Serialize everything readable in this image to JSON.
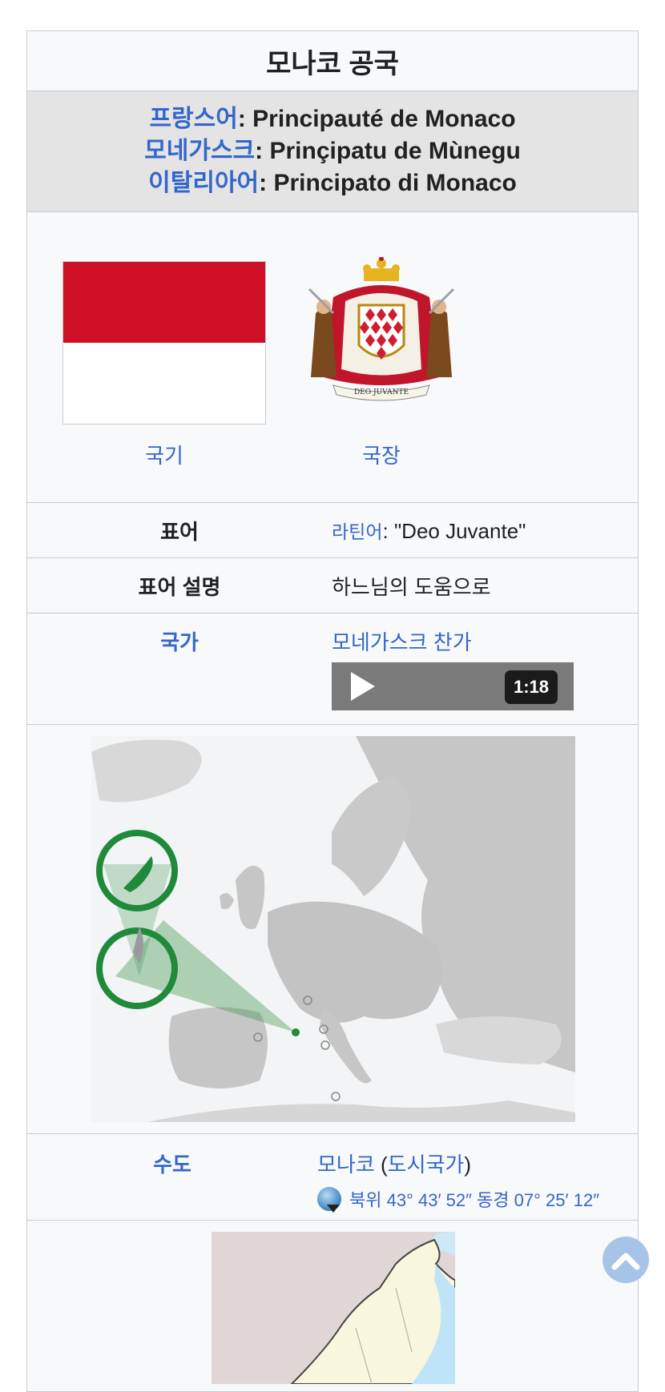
{
  "infobox": {
    "title": "모나코 공국",
    "native_names": [
      {
        "lang": "프랑스어",
        "sep": ": ",
        "name": "Principauté de Monaco"
      },
      {
        "lang": "모네가스크",
        "sep": ": ",
        "name": "Prinçipatu de Mùnegu"
      },
      {
        "lang": "이탈리아어",
        "sep": ": ",
        "name": "Principato di Monaco"
      }
    ],
    "flag_caption": "국기",
    "coa_caption": "국장",
    "coa_motto_ribbon": "DEO JUVANTE",
    "motto": {
      "label": "표어",
      "lang": "라틴어",
      "sep": ": ",
      "text": "\"Deo Juvante\""
    },
    "motto_desc": {
      "label": "표어 설명",
      "text": "하느님의 도움으로"
    },
    "anthem": {
      "label": "국가",
      "name": "모네가스크 찬가",
      "duration": "1:18"
    },
    "capital": {
      "label": "수도",
      "name": "모나코",
      "open_paren": " (",
      "type": "도시국가",
      "close_paren": ")",
      "coords": "북위 43° 43′ 52″ 동경 07° 25′ 12″"
    }
  },
  "colors": {
    "link": "#3366cc",
    "flag_red": "#ce1126",
    "highlight_green": "#1e8a3a",
    "land_gray": "#c6c6c6"
  },
  "icons": {
    "play": "play-icon",
    "globe": "globe-icon",
    "scroll_top": "chevron-up-icon"
  }
}
